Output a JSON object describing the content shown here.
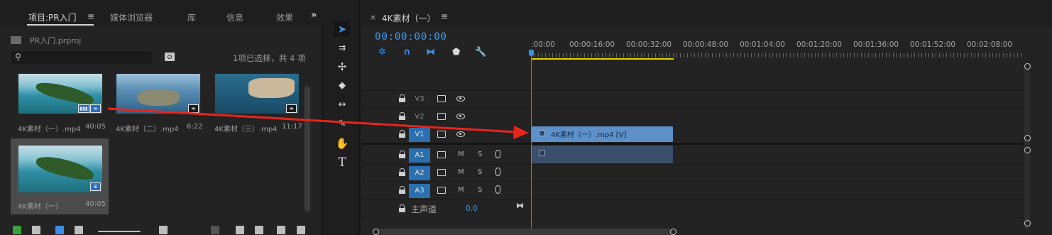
{
  "project_panel": {
    "tabs": [
      "项目:PR入门",
      "媒体浏览器",
      "库",
      "信息",
      "效果"
    ],
    "menu_glyph": "≡",
    "overflow_glyph": "»",
    "project_file": "PR入门.prproj",
    "search": {
      "value": "",
      "placeholder": ""
    },
    "selection_status": "1项已选择，共 4 项",
    "clips": [
      {
        "name": "4K素材（一）.mp4",
        "duration": "40:05"
      },
      {
        "name": "4K素材（二）.mp4",
        "duration": "6:22"
      },
      {
        "name": "4K素材（三）.mp4",
        "duration": "11:17"
      },
      {
        "name": "4K素材（一）",
        "duration": "40:05"
      }
    ]
  },
  "tools": [
    "selection-tool",
    "track-select-tool",
    "ripple-edit-tool",
    "razor-tool",
    "slip-tool",
    "pen-tool",
    "hand-tool",
    "type-tool"
  ],
  "tool_glyphs": {
    "type": "T",
    "hand": "✋"
  },
  "timeline": {
    "tab": "4K素材（一）",
    "close_glyph": "×",
    "menu_glyph": "≡",
    "timecode": "00:00:00:00",
    "ruler": [
      ":00:00",
      "00:00:16:00",
      "00:00:32:00",
      "00:00:48:00",
      "00:01:04:00",
      "00:01:20:00",
      "00:01:36:00",
      "00:01:52:00",
      "00:02:08:00"
    ],
    "video_tracks": [
      "V3",
      "V2",
      "V1"
    ],
    "audio_tracks": [
      "A1",
      "A2",
      "A3"
    ],
    "mute_label": "M",
    "solo_label": "S",
    "master": {
      "label": "主声道",
      "value": "0.0"
    },
    "video_clip": "4K素材（一）.mp4 [V]"
  },
  "colors": {
    "accent": "#3b8fe8",
    "workarea": "#e0d400",
    "arrow": "#e8251c",
    "clip_video": "#5d8fc9",
    "clip_audio": "#3a4f6b"
  }
}
